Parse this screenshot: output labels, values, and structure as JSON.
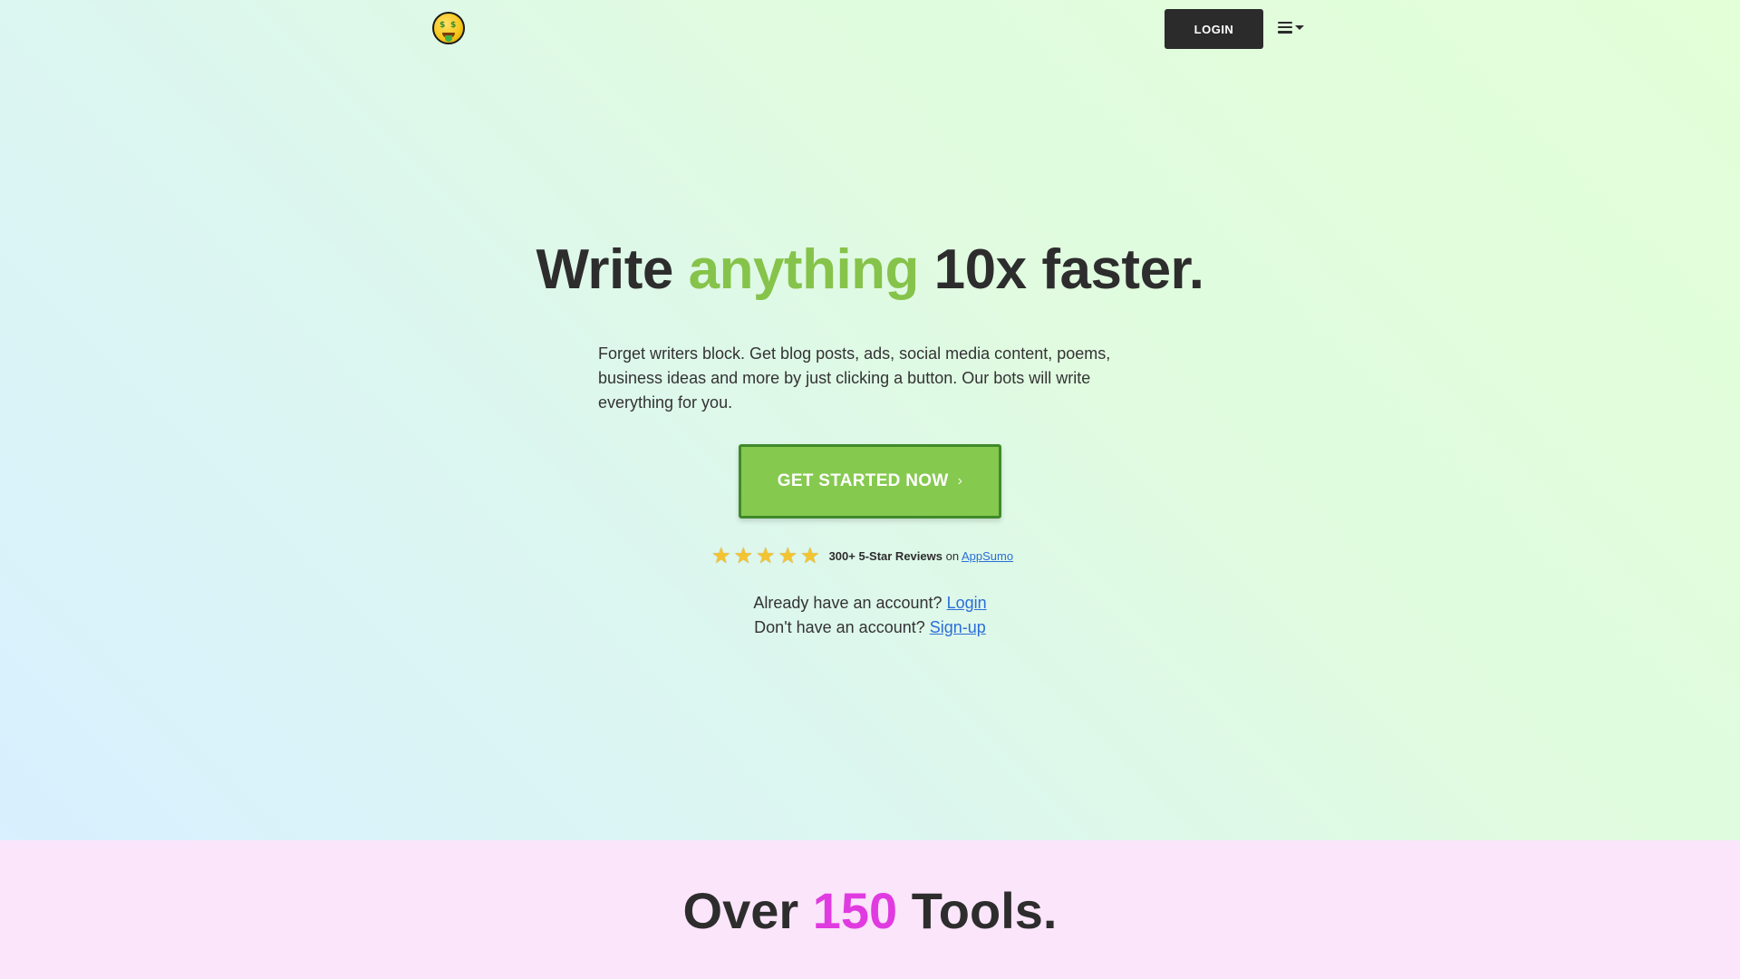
{
  "nav": {
    "logo_icon": "money-mouth-face-icon",
    "login_label": "LOGIN",
    "menu_icon": "hamburger-menu-icon"
  },
  "hero": {
    "headline_part1": "Write ",
    "headline_highlight": "anything",
    "headline_part2": " 10x faster.",
    "highlight_color": "#86c34a",
    "subtext": "Forget writers block. Get blog posts, ads, social media content, poems, business ideas and more by just clicking a button. Our bots will write everything for you.",
    "cta_label": "GET STARTED NOW",
    "cta_icon": "chevron-right-icon",
    "cta_color": "#86c94f",
    "rating_stars": 5,
    "reviews_text": "300+ 5-Star Reviews",
    "reviews_on": "on",
    "reviews_link": "AppSumo",
    "login_prompt": "Already have an account?",
    "login_link": "Login",
    "signup_prompt": "Don't have an account?",
    "signup_link": "Sign-up"
  },
  "tools": {
    "title_part1": "Over ",
    "title_highlight": "150",
    "title_part2": " Tools.",
    "highlight_color": "#e03be0"
  }
}
